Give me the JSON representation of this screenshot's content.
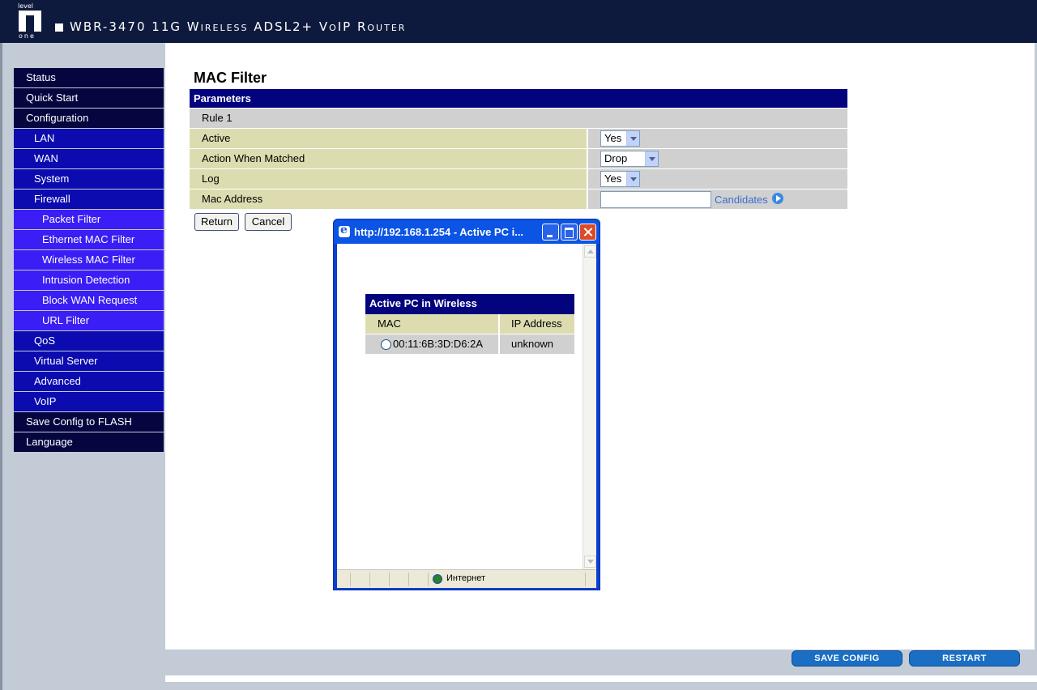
{
  "header": {
    "logo_top": "level",
    "logo_bottom": "one",
    "title": "WBR-3470 11G Wireless ADSL2+ VoIP Router"
  },
  "sidebar": {
    "items": [
      {
        "label": "Status",
        "level": 0
      },
      {
        "label": "Quick Start",
        "level": 0
      },
      {
        "label": "Configuration",
        "level": 0
      },
      {
        "label": "LAN",
        "level": 1
      },
      {
        "label": "WAN",
        "level": 1
      },
      {
        "label": "System",
        "level": 1
      },
      {
        "label": "Firewall",
        "level": 1
      },
      {
        "label": "Packet Filter",
        "level": 2
      },
      {
        "label": "Ethernet MAC Filter",
        "level": 2
      },
      {
        "label": "Wireless MAC Filter",
        "level": 2
      },
      {
        "label": "Intrusion Detection",
        "level": 2
      },
      {
        "label": "Block WAN Request",
        "level": 2
      },
      {
        "label": "URL Filter",
        "level": 2
      },
      {
        "label": "QoS",
        "level": 1
      },
      {
        "label": "Virtual Server",
        "level": 1
      },
      {
        "label": "Advanced",
        "level": 1
      },
      {
        "label": "VoIP",
        "level": 1
      },
      {
        "label": "Save Config to FLASH",
        "level": 0
      },
      {
        "label": "Language",
        "level": 0
      }
    ]
  },
  "main": {
    "title": "MAC Filter",
    "params_header": "Parameters",
    "rule_label": "Rule 1",
    "rows": {
      "active_label": "Active",
      "active_value": "Yes",
      "action_label": "Action When Matched",
      "action_value": "Drop",
      "log_label": "Log",
      "log_value": "Yes",
      "mac_label": "Mac Address",
      "mac_value": "",
      "candidates": "Candidates"
    },
    "return_label": "Return",
    "cancel_label": "Cancel"
  },
  "footer": {
    "save_label": "SAVE CONFIG",
    "restart_label": "RESTART"
  },
  "popup": {
    "title": "http://192.168.1.254 - Active PC i...",
    "table_title": "Active PC in Wireless",
    "col_mac": "MAC",
    "col_ip": "IP Address",
    "rows": [
      {
        "mac": "00:11:6B:3D:D6:2A",
        "ip": "unknown"
      }
    ],
    "status_zone": "Интернет"
  },
  "colors": {
    "header_bg": "#0e1a3d",
    "menu_level0": "#050540",
    "menu_level1": "#0b0bb0",
    "menu_level2": "#3a1ef5",
    "table_header": "#03037d",
    "label_cell": "#dcdcb0",
    "value_cell": "#d0d0d0"
  }
}
